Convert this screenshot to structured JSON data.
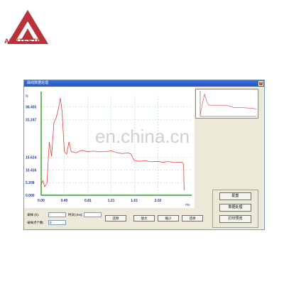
{
  "brand": {
    "logo_text": "ANYTESTER",
    "color": "#b8323a"
  },
  "window": {
    "title": "曲线数据处理",
    "close_glyph": "×"
  },
  "watermark": "en.china.cn",
  "chart_data": {
    "type": "line",
    "y_unit": "N",
    "x_unit": "ms",
    "yticks": [
      "0.000",
      "5.208",
      "10.416",
      "15.624",
      "31.247",
      "36.455"
    ],
    "ytick_values": [
      0,
      5.208,
      10.416,
      15.624,
      31.247,
      36.455
    ],
    "xticks": [
      "0.00",
      "0.40",
      "0.81",
      "1.21",
      "1.61",
      "2.02"
    ],
    "xtick_values": [
      0,
      0.4,
      0.81,
      1.21,
      1.61,
      2.02
    ],
    "xlim": [
      0,
      2.6
    ],
    "ylim": [
      0,
      41
    ],
    "grid": true,
    "series": [
      {
        "color": "#e04040",
        "x": [
          0,
          0.03,
          0.06,
          0.1,
          0.14,
          0.18,
          0.22,
          0.26,
          0.3,
          0.33,
          0.36,
          0.4,
          0.44,
          0.48,
          0.52,
          0.6,
          0.7,
          0.81,
          0.9,
          1.0,
          1.1,
          1.21,
          1.3,
          1.4,
          1.5,
          1.55,
          1.61,
          1.7,
          1.8,
          1.9,
          2.02,
          2.1,
          2.2,
          2.3,
          2.4,
          2.45,
          2.46,
          2.47
        ],
        "y": [
          4.5,
          6.0,
          3.5,
          5.0,
          22.0,
          16.0,
          30.0,
          32.0,
          36.0,
          40.0,
          35.0,
          18.0,
          17.0,
          22.0,
          18.0,
          17.5,
          18.5,
          18.0,
          18.2,
          17.9,
          18.0,
          18.3,
          17.6,
          17.2,
          17.5,
          17.0,
          14.3,
          14.0,
          14.2,
          13.8,
          14.0,
          13.6,
          13.9,
          13.5,
          13.7,
          13.4,
          12.5,
          2.0
        ]
      }
    ],
    "mini_series": {
      "x": [
        0,
        0.1,
        0.2,
        0.3,
        0.4,
        0.8,
        1.2,
        1.6,
        2.0,
        2.4,
        2.6
      ],
      "y": [
        2,
        20,
        36,
        24,
        18,
        18,
        18,
        14,
        14,
        13,
        12
      ]
    }
  },
  "controls": {
    "sample_label": "采样 (h):",
    "sample_value": "",
    "time_label": "时间 (ms):",
    "time_value": "",
    "points_label": "采样点个数:",
    "points_value": "0",
    "buttons": [
      "还原",
      "放大",
      "缩小",
      "还原"
    ],
    "side_buttons": [
      "配置",
      "数据处理",
      "打印预览"
    ]
  }
}
